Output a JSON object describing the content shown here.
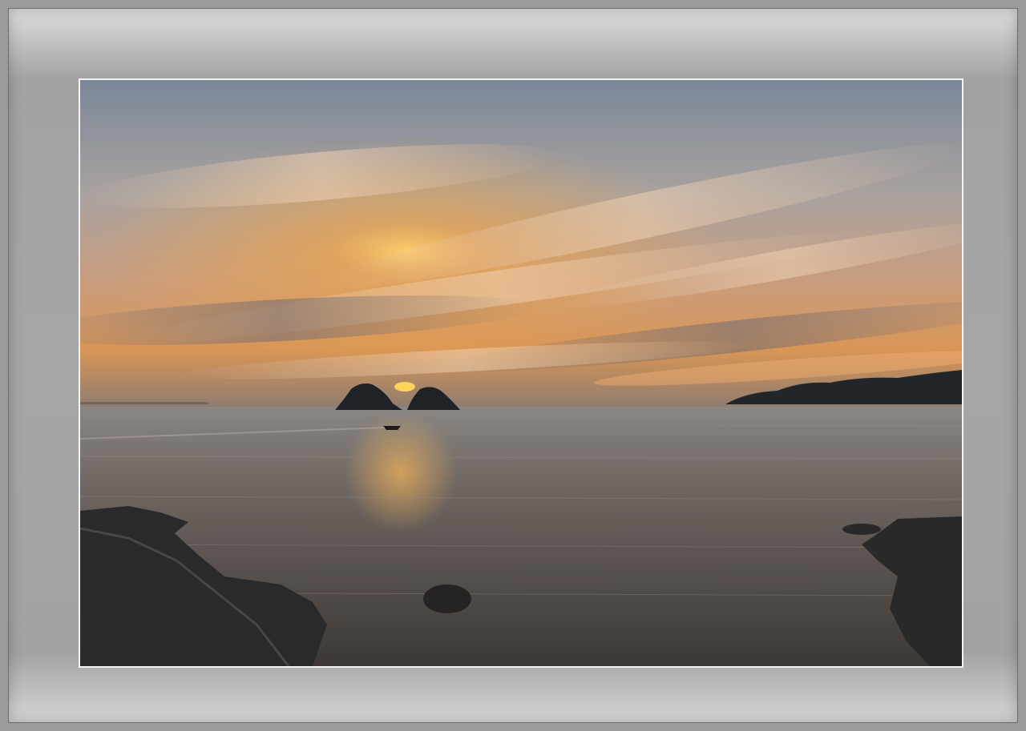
{
  "scene": {
    "subject": "sunset-over-sea",
    "colors": {
      "sky_top": "#7d8a9a",
      "sky_mid": "#c9a48a",
      "sky_glow": "#f2a544",
      "sun": "#ffd35a",
      "sea": "#6e6560",
      "rock": "#2b2a2a",
      "silhouette": "#1f2226",
      "mat": "#a6a6a6",
      "border": "#f4f4f4"
    }
  }
}
